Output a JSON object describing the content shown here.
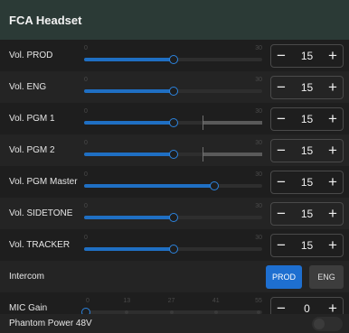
{
  "window": {
    "title": "FCA Headset"
  },
  "colors": {
    "accent": "#1e6fd0",
    "header_bg": "#2b3a36",
    "panel_bg": "#1e1e1e"
  },
  "volume_rows": [
    {
      "label": "Vol. PROD",
      "min": "0",
      "max": "30",
      "value": "15",
      "level": 15
    },
    {
      "label": "Vol. ENG",
      "min": "0",
      "max": "30",
      "value": "15",
      "level": 15
    },
    {
      "label": "Vol. PGM 1",
      "min": "0",
      "max": "30",
      "value": "15",
      "level": 15,
      "limit": 20
    },
    {
      "label": "Vol. PGM 2",
      "min": "0",
      "max": "30",
      "value": "15",
      "level": 15,
      "limit": 20
    },
    {
      "label": "Vol. PGM Master",
      "min": "0",
      "max": "30",
      "value": "15",
      "level": 22
    },
    {
      "label": "Vol. SIDETONE",
      "min": "0",
      "max": "30",
      "value": "15",
      "level": 15
    },
    {
      "label": "Vol. TRACKER",
      "min": "0",
      "max": "30",
      "value": "15",
      "level": 15
    }
  ],
  "stepper": {
    "minus_icon": "minus-icon",
    "plus_icon": "plus-icon",
    "minus": "−",
    "plus": "+"
  },
  "intercom": {
    "label": "Intercom",
    "options": [
      "PROD",
      "ENG"
    ],
    "selected": "PROD"
  },
  "mic_gain": {
    "label": "MIC  Gain",
    "ticks": [
      "0",
      "13",
      "27",
      "41",
      "55"
    ],
    "value": "0",
    "level": 0
  },
  "phantom": {
    "label": "Phantom Power 48V",
    "enabled": false
  }
}
